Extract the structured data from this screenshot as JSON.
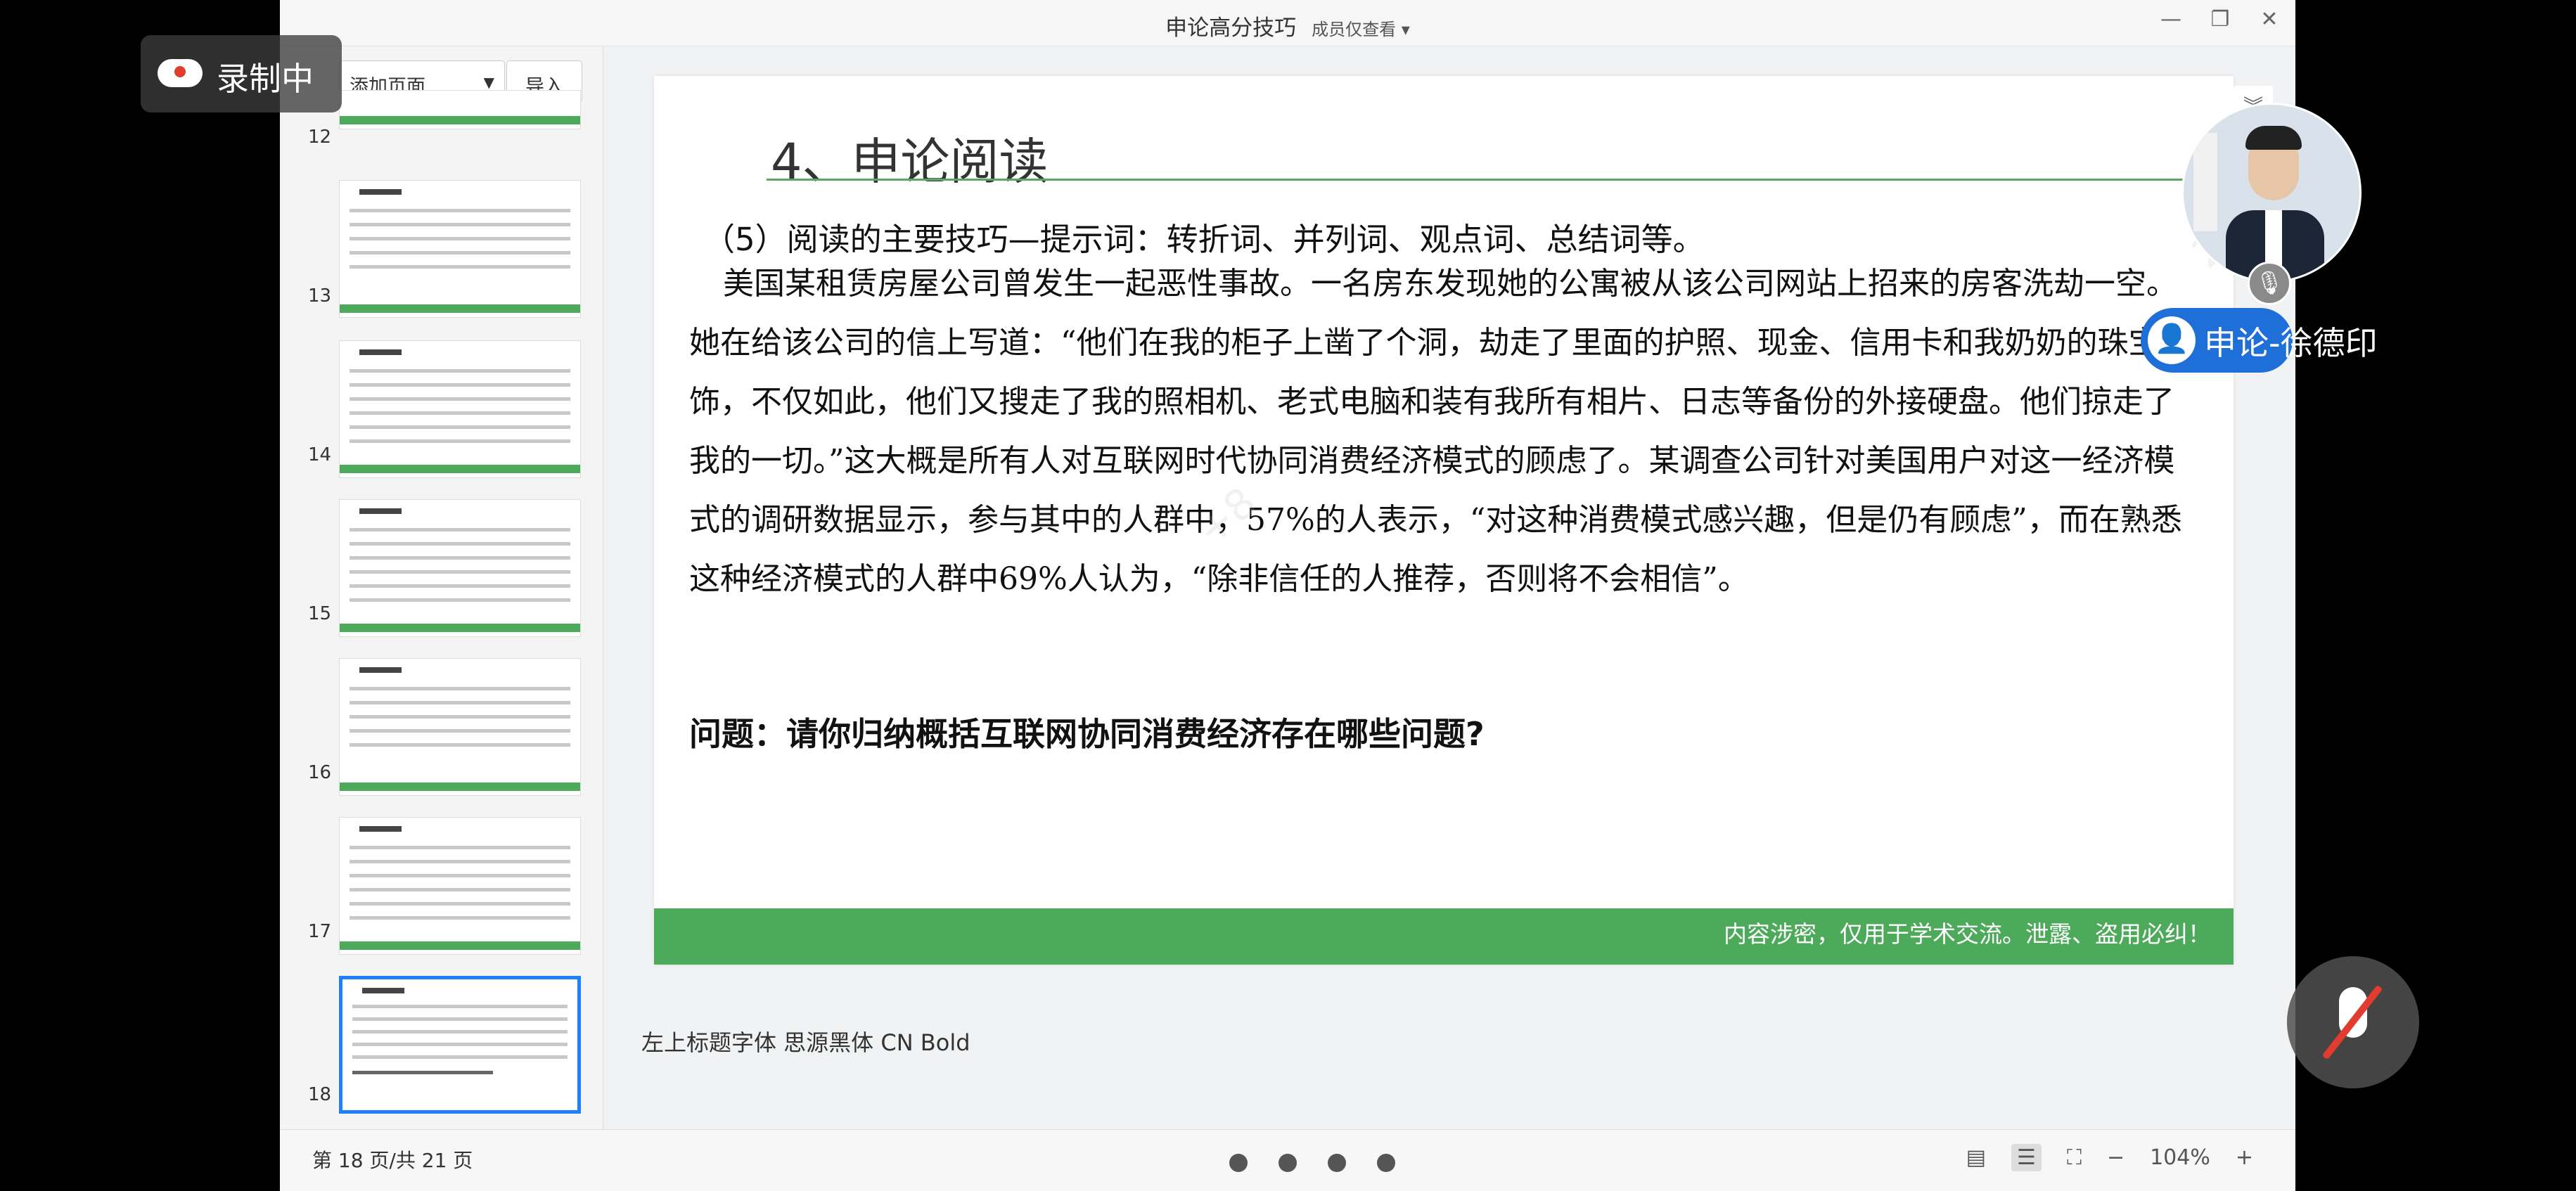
{
  "recording": {
    "label": "录制中"
  },
  "window": {
    "title": "申论高分技巧",
    "visibility": "成员仅查看"
  },
  "sidebar": {
    "add_page": "添加页面",
    "import": "导入",
    "thumbnails": [
      {
        "num": "12"
      },
      {
        "num": "13"
      },
      {
        "num": "14"
      },
      {
        "num": "15"
      },
      {
        "num": "16"
      },
      {
        "num": "17"
      },
      {
        "num": "18"
      }
    ]
  },
  "slide": {
    "title": "4、申论阅读",
    "subtitle": "（5）阅读的主要技巧—提示词：转折词、并列词、观点词、总结词等。",
    "body": "美国某租赁房屋公司曾发生一起恶性事故。一名房东发现她的公寓被从该公司网站上招来的房客洗劫一空。她在给该公司的信上写道：“他们在我的柜子上凿了个洞，劫走了里面的护照、现金、信用卡和我奶奶的珠宝首饰，不仅如此，他们又搜走了我的照相机、老式电脑和装有我所有相片、日志等备份的外接硬盘。他们掠走了我的一切。”这大概是所有人对互联网时代协同消费经济模式的顾虑了。某调查公司针对美国用户对这一经济模式的调研数据显示，参与其中的人群中，57%的人表示，“对这种消费模式感兴趣，但是仍有顾虑”，而在熟悉这种经济模式的人群中69%人认为，“除非信任的人推荐，否则将不会相信”。",
    "question": "问题：请你归纳概括互联网协同消费经济存在哪些问题?",
    "footer": "内容涉密，仅用于学术交流。泄露、盗用必纠！"
  },
  "note": "左上标题字体 思源黑体 CN Bold",
  "status": {
    "page_info": "第 18 页/共 21 页",
    "zoom": "104%"
  },
  "presenter": {
    "name": "申论-徐德印"
  },
  "colors": {
    "accent_green": "#4caa5a",
    "selection_blue": "#1e7fff",
    "presenter_blue": "#1f6fd8"
  }
}
